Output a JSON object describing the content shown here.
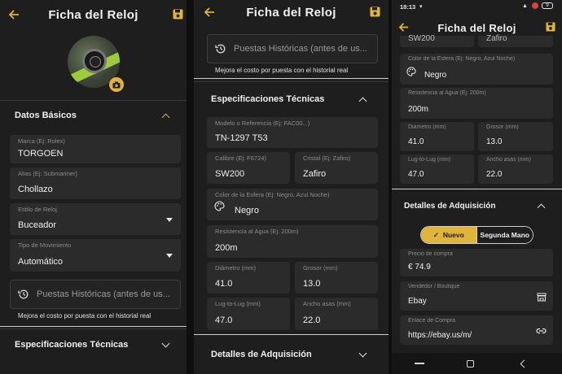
{
  "colors": {
    "accent": "#e0b43a",
    "background": "#1e1e1e",
    "field": "#2b2b2b"
  },
  "screens": [
    {
      "title": "Ficha del Reloj",
      "icons": {
        "back": "arrow-back-icon",
        "save": "save-icon",
        "camera": "camera-icon"
      },
      "section_basic": "Datos Básicos",
      "fields": {
        "brand_label": "Marca (Ej: Rolex)",
        "brand_value": "TORGOEN",
        "alias_label": "Alias (Ej: Submariner)",
        "alias_value": "Chollazo",
        "style_label": "Estilo de Reloj",
        "style_value": "Buceador",
        "movement_label": "Tipo de Movimiento",
        "movement_value": "Automático"
      },
      "history_placeholder": "Puestas Históricas (antes de us...",
      "history_hint": "Mejora el costo por puesta con el historial real",
      "section_specs": "Especificaciones Técnicas"
    },
    {
      "title": "Ficha del Reloj",
      "history_placeholder": "Puestas Históricas (antes de us...",
      "history_hint": "Mejora el costo por puesta con el historial real",
      "section_specs": "Especificaciones Técnicas",
      "fields": {
        "model_label": "Modelo o Referencia (Ej: FAC00...)",
        "model_value": "TN-1297 T53",
        "caliber_label": "Calibre (Ej: F6724)",
        "caliber_value": "SW200",
        "crystal_label": "Cristal (Ej: Zafiro)",
        "crystal_value": "Zafiro",
        "dial_label": "Color de la Esfera (Ej: Negro, Azul Noche)",
        "dial_value": "Negro",
        "water_label": "Resistencia al Agua (Ej: 200m)",
        "water_value": "200m",
        "diameter_label": "Diámetro (mm)",
        "diameter_value": "41.0",
        "thickness_label": "Grosor (mm)",
        "thickness_value": "13.0",
        "l2l_label": "Lug-to-Lug (mm)",
        "l2l_value": "47.0",
        "lugwidth_label": "Ancho asas (mm)",
        "lugwidth_value": "22.0"
      },
      "section_acq": "Detalles de Adquisición"
    },
    {
      "status_time": "18:13",
      "status_battery": "9",
      "title": "Ficha del Reloj",
      "top_cut_left": "SW200",
      "top_cut_right": "Zafiro",
      "fields": {
        "dial_label": "Color de la Esfera (Ej: Negro, Azul Noche)",
        "dial_value": "Negro",
        "water_label": "Resistencia al Agua (Ej: 200m)",
        "water_value": "200m",
        "diameter_label": "Diámetro (mm)",
        "diameter_value": "41.0",
        "thickness_label": "Grosor (mm)",
        "thickness_value": "13.0",
        "l2l_label": "Lug-to-Lug (mm)",
        "l2l_value": "47.0",
        "lugwidth_label": "Ancho asas (mm)",
        "lugwidth_value": "22.0",
        "price_label": "Precio de compra",
        "price_value": "€ 74.9",
        "vendor_label": "Vendedor / Boutique",
        "vendor_value": "Ebay",
        "link_label": "Enlace de Compra",
        "link_value": "https://ebay.us/m/"
      },
      "section_acq": "Detalles de Adquisición",
      "condition_options": [
        "Nuevo",
        "Segunda Mano"
      ],
      "condition_selected": "Nuevo"
    }
  ]
}
